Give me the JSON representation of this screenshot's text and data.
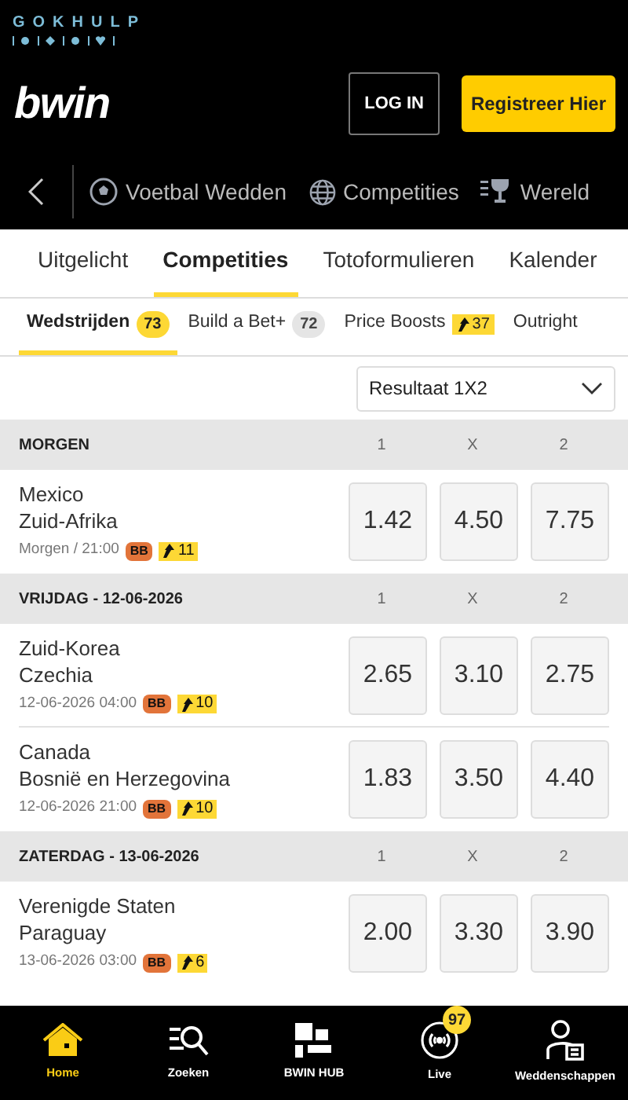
{
  "banner": {
    "brand": "GOKHULP"
  },
  "header": {
    "logo": "bwin",
    "login": "LOG IN",
    "register": "Registreer Hier"
  },
  "sport_nav": [
    {
      "kind": "football",
      "label": "Voetbal Wedden"
    },
    {
      "kind": "globe",
      "label": "Competities"
    },
    {
      "kind": "trophy",
      "label": "Wereld"
    }
  ],
  "tabs": [
    {
      "label": "Uitgelicht",
      "selected": false
    },
    {
      "label": "Competities",
      "selected": true
    },
    {
      "label": "Totoformulieren",
      "selected": false
    },
    {
      "label": "Kalender",
      "selected": false
    }
  ],
  "subtabs": [
    {
      "label": "Wedstrijden",
      "badge": "73",
      "kind": "count",
      "selected": true
    },
    {
      "label": "Build a Bet+",
      "badge": "72",
      "kind": "count",
      "selected": false
    },
    {
      "label": "Price Boosts",
      "badge": "37",
      "kind": "boost",
      "selected": false
    },
    {
      "label": "Outright",
      "kind": "plain",
      "selected": false
    }
  ],
  "market_select": {
    "value": "Resultaat 1X2"
  },
  "sections": [
    {
      "title": "MORGEN",
      "columns": [
        "1",
        "X",
        "2"
      ],
      "matches": [
        {
          "home": "Mexico",
          "away": "Zuid-Afrika",
          "time": "Morgen / 21:00",
          "bb": "BB",
          "boosts": "11",
          "odds": [
            "1.42",
            "4.50",
            "7.75"
          ]
        }
      ]
    },
    {
      "title": "VRIJDAG - 12-06-2026",
      "columns": [
        "1",
        "X",
        "2"
      ],
      "matches": [
        {
          "home": "Zuid-Korea",
          "away": "Czechia",
          "time": "12-06-2026 04:00",
          "bb": "BB",
          "boosts": "10",
          "odds": [
            "2.65",
            "3.10",
            "2.75"
          ]
        },
        {
          "home": "Canada",
          "away": "Bosnië en Herzegovina",
          "time": "12-06-2026 21:00",
          "bb": "BB",
          "boosts": "10",
          "odds": [
            "1.83",
            "3.50",
            "4.40"
          ]
        }
      ]
    },
    {
      "title": "ZATERDAG - 13-06-2026",
      "columns": [
        "1",
        "X",
        "2"
      ],
      "matches": [
        {
          "home": "Verenigde Staten",
          "away": "Paraguay",
          "time": "13-06-2026 03:00",
          "bb": "BB",
          "boosts": "6",
          "odds": [
            "2.00",
            "3.30",
            "3.90"
          ]
        }
      ]
    }
  ],
  "bottom_nav": [
    {
      "kind": "home",
      "label": "Home",
      "selected": true
    },
    {
      "kind": "search",
      "label": "Zoeken",
      "selected": false
    },
    {
      "kind": "hub",
      "label": "BWIN HUB",
      "selected": false
    },
    {
      "kind": "live",
      "label": "Live",
      "badge": "97",
      "selected": false
    },
    {
      "kind": "bets",
      "label": "Weddenschappen",
      "selected": false
    }
  ]
}
